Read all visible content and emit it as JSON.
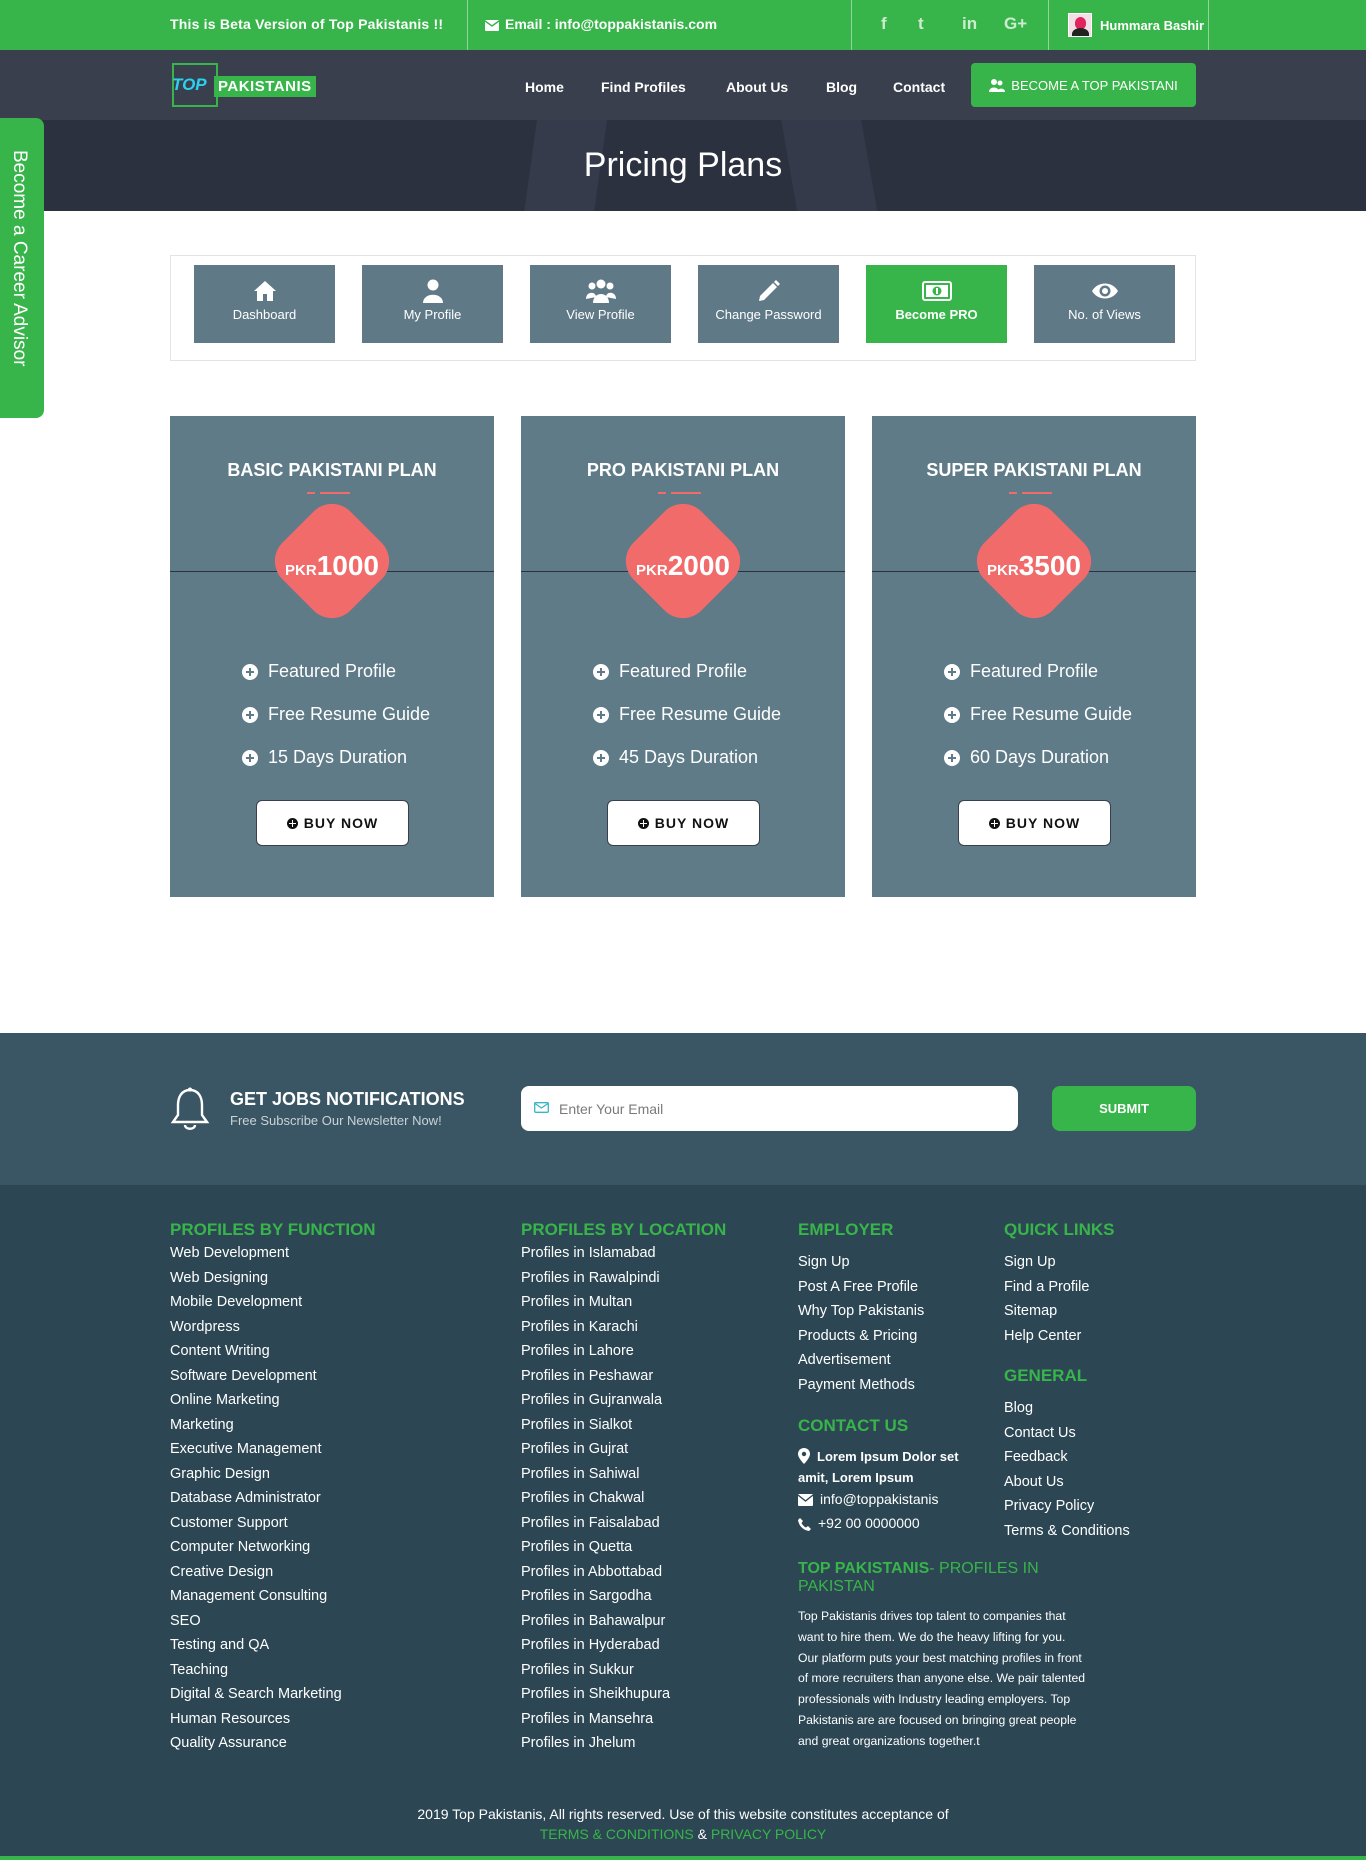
{
  "topbar": {
    "beta_text": "This is Beta Version of Top Pakistanis !!",
    "email_text": "Email : info@toppakistanis.com",
    "social": [
      "f",
      "t",
      "in",
      "G+"
    ],
    "user_name": "Hummara Bashir"
  },
  "nav": {
    "logo_top": "TOP",
    "logo_pakistanis": "PAKISTANIS",
    "items": [
      "Home",
      "Find Profiles",
      "About Us",
      "Blog",
      "Contact"
    ],
    "cta": "BECOME A TOP PAKISTANI"
  },
  "hero": {
    "title": "Pricing Plans"
  },
  "side_tab": "Become a Career Advisor",
  "dashboard_tabs": [
    {
      "label": "Dashboard",
      "icon": "home-icon"
    },
    {
      "label": "My Profile",
      "icon": "user-icon"
    },
    {
      "label": "View Profile",
      "icon": "users-icon"
    },
    {
      "label": "Change Password",
      "icon": "pencil-icon"
    },
    {
      "label": "Become PRO",
      "icon": "money-icon",
      "active": true
    },
    {
      "label": "No. of Views",
      "icon": "eye-icon"
    }
  ],
  "plans": [
    {
      "name": "BASIC PAKISTANI PLAN",
      "currency": "PKR",
      "price": "1000",
      "features": [
        "Featured Profile",
        "Free Resume Guide",
        "15 Days Duration"
      ],
      "button": "BUY NOW"
    },
    {
      "name": "PRO PAKISTANI PLAN",
      "currency": "PKR",
      "price": "2000",
      "features": [
        "Featured Profile",
        "Free Resume Guide",
        "45 Days Duration"
      ],
      "button": "BUY NOW"
    },
    {
      "name": "SUPER PAKISTANI PLAN",
      "currency": "PKR",
      "price": "3500",
      "features": [
        "Featured Profile",
        "Free Resume Guide",
        "60 Days Duration"
      ],
      "button": "BUY NOW"
    }
  ],
  "newsletter": {
    "title": "GET JOBS NOTIFICATIONS",
    "subtitle": "Free Subscribe Our Newsletter Now!",
    "placeholder": "Enter Your Email",
    "submit": "SUBMIT"
  },
  "footer": {
    "function_heading": "PROFILES BY FUNCTION",
    "function_links": [
      "Web Development",
      "Web Designing",
      "Mobile Development",
      "Wordpress",
      "Content Writing",
      "Software Development",
      "Online Marketing",
      "Marketing",
      "Executive Management",
      "Graphic Design",
      "Database Administrator",
      "Customer Support",
      "Computer Networking",
      "Creative Design",
      "Management Consulting",
      "SEO",
      "Testing and QA",
      "Teaching",
      "Digital & Search Marketing",
      "Human Resources",
      "Quality Assurance"
    ],
    "location_heading": "PROFILES BY LOCATION",
    "location_links": [
      "Profiles in Islamabad",
      "Profiles in Rawalpindi",
      "Profiles in Multan",
      "Profiles in Karachi",
      "Profiles in Lahore",
      "Profiles in Peshawar",
      "Profiles in Gujranwala",
      "Profiles in Sialkot",
      "Profiles in Gujrat",
      "Profiles in Sahiwal",
      "Profiles in Chakwal",
      "Profiles in Faisalabad",
      "Profiles in Quetta",
      "Profiles in Abbottabad",
      "Profiles in Sargodha",
      "Profiles in Bahawalpur",
      "Profiles in Hyderabad",
      "Profiles in Sukkur",
      "Profiles in Sheikhupura",
      "Profiles in Mansehra",
      "Profiles in Jhelum"
    ],
    "employer_heading": "EMPLOYER",
    "employer_links": [
      "Sign Up",
      "Post A Free Profile",
      "Why Top Pakistanis",
      "Products & Pricing",
      "Advertisement",
      "Payment Methods"
    ],
    "contact_heading": "CONTACT US",
    "contact_address_1": "Lorem Ipsum Dolor set",
    "contact_address_2": "amit, Lorem Ipsum",
    "contact_email": "info@toppakistanis",
    "contact_phone": "+92 00 0000000",
    "quick_heading": "QUICK LINKS",
    "quick_links": [
      "Sign Up",
      "Find a Profile",
      "Sitemap",
      "Help Center"
    ],
    "general_heading": "GENERAL",
    "general_links": [
      "Blog",
      "Contact Us",
      "Feedback",
      "About Us",
      "Privacy Policy",
      "Terms & Conditions"
    ],
    "about_title_strong": "TOP PAKISTANIS",
    "about_title_rest": "- PROFILES IN PAKISTAN",
    "about_text": "Top Pakistanis drives top talent to companies that want to hire them. We do the heavy lifting for you. Our platform puts your best matching profiles in front of more recruiters than anyone else. We pair talented professionals with Industry leading employers. Top Pakistanis are are focused on bringing great people and great organizations together.t",
    "copyright": "2019 Top Pakistanis, All rights reserved. Use of this website constitutes acceptance of",
    "terms": "TERMS & CONDITIONS",
    "amp": "&",
    "privacy": "PRIVACY POLICY"
  },
  "colors": {
    "green": "#38b54a",
    "nav": "#3a3f4d",
    "plan": "#5f7b88",
    "price_diamond": "#f16b6b",
    "footer": "#2c4653"
  }
}
